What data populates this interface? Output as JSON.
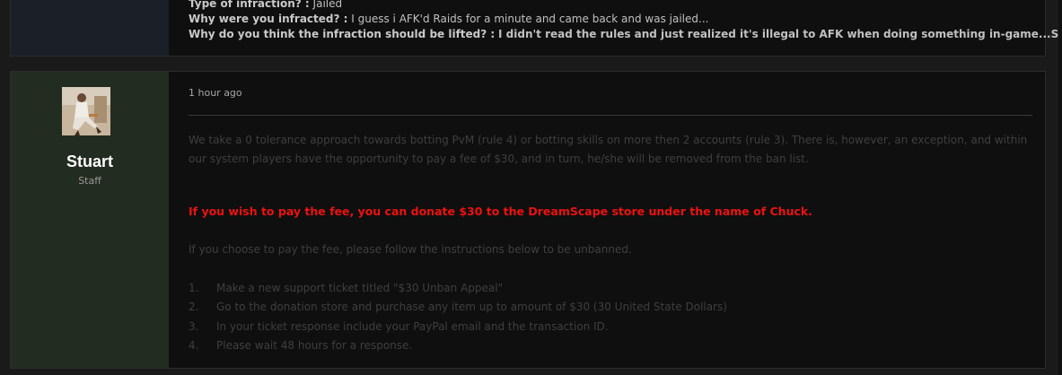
{
  "previous_post": {
    "lines": [
      {
        "label": "Type of infraction? :",
        "answer": "Jailed",
        "answer_bold": false
      },
      {
        "label": "Why were you infracted? :",
        "answer": "I guess i AFK'd Raids for a minute and came back and was jailed...",
        "answer_bold": false
      },
      {
        "label": "Why do you think the infraction should be lifted? :",
        "answer": "I didn't read the rules and just realized it's illegal to AFK when doing something in-game...Sorry.:(",
        "answer_bold": true
      }
    ]
  },
  "post": {
    "author": {
      "name": "Stuart",
      "role": "Staff"
    },
    "timestamp": "1 hour ago",
    "paragraph_1": "We take a 0 tolerance approach towards botting PvM (rule 4) or botting skills on more then 2 accounts (rule 3). There is, however, an exception, and within our system players have the opportunity to pay a fee of $30, and in turn, he/she will be removed from the ban list.",
    "highlight": "If you wish to pay the fee, you can donate $30 to the DreamScape store under the name of Chuck.",
    "paragraph_2": "If you choose to pay the fee, please follow the instructions below to be unbanned.",
    "steps": [
      {
        "num": "1.",
        "text": "Make a new support ticket titled \"$30 Unban Appeal\""
      },
      {
        "num": "2.",
        "text": "Go to the donation store and purchase any item up to amount of $30 (30 United State Dollars)"
      },
      {
        "num": "3.",
        "text": "In your ticket response include your PayPal email and the transaction ID."
      },
      {
        "num": "4.",
        "text": "Please wait 48 hours for a response."
      }
    ]
  },
  "colors": {
    "highlight": "#ee1111",
    "author_panel": "#232c21",
    "prev_author_panel": "#1b1f27"
  }
}
